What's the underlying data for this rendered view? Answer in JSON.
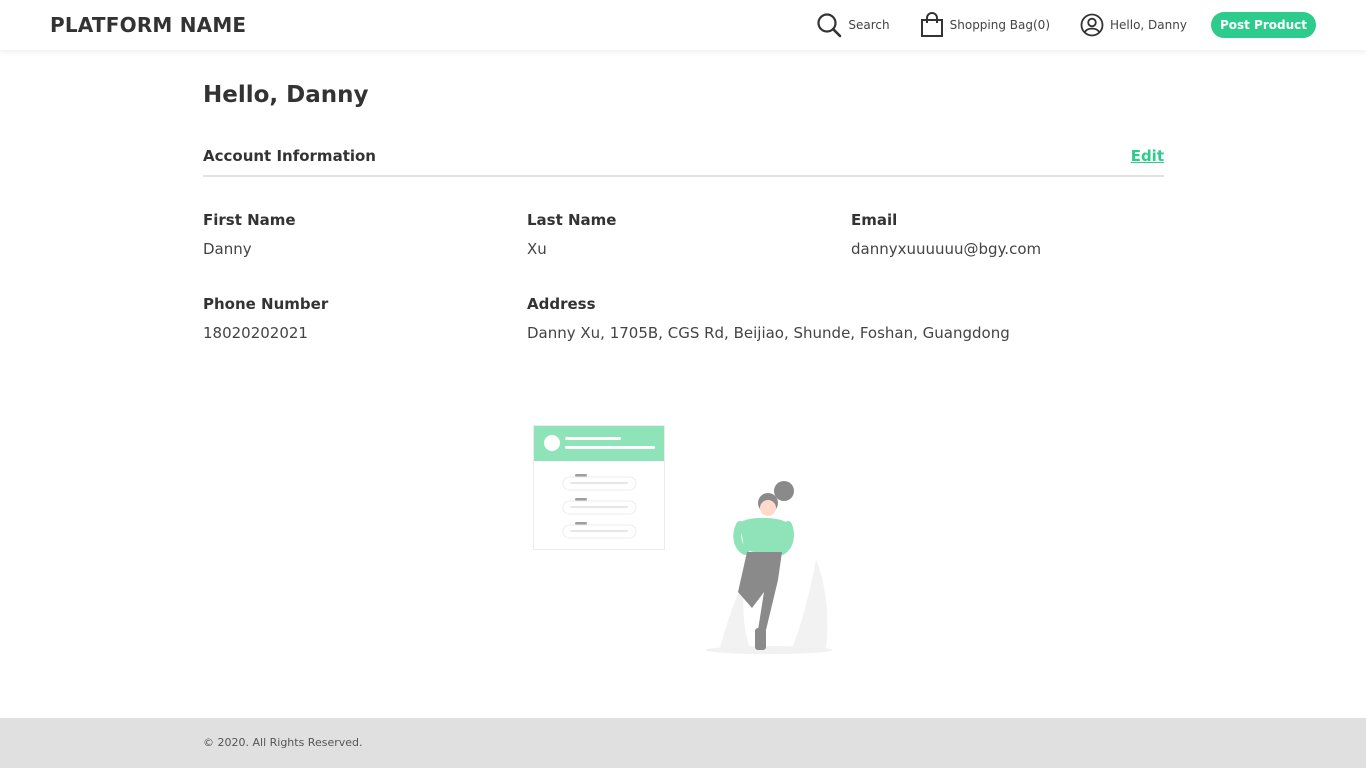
{
  "header": {
    "brand": "PLATFORM NAME",
    "search_label": "Search",
    "bag_label": "Shopping Bag(0)",
    "user_label": "Hello, Danny",
    "post_button": "Post Product"
  },
  "main": {
    "greeting": "Hello, Danny",
    "section_title": "Account Information",
    "edit_label": "Edit",
    "fields": {
      "first_name": {
        "label": "First Name",
        "value": "Danny"
      },
      "last_name": {
        "label": "Last Name",
        "value": "Xu"
      },
      "email": {
        "label": "Email",
        "value": "dannyxuuuuuu@bgy.com"
      },
      "phone": {
        "label": "Phone Number",
        "value": "18020202021"
      },
      "address": {
        "label": "Address",
        "value": "Danny Xu, 1705B, CGS Rd, Beijiao, Shunde, Foshan, Guangdong"
      }
    }
  },
  "footer": {
    "copyright": "© 2020. All Rights Reserved."
  },
  "theme": {
    "accent": "#2ecc8c",
    "text": "#333333",
    "footer_bg": "#e0e0e0"
  },
  "icons": [
    "search-icon",
    "shopping-bag-icon",
    "user-circle-icon"
  ]
}
